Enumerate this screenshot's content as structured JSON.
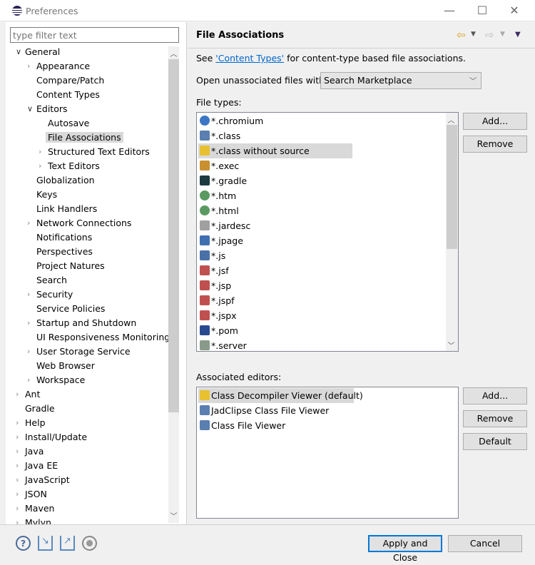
{
  "window": {
    "title": "Preferences",
    "minimize": "—",
    "maximize": "☐",
    "close": "✕"
  },
  "filter": {
    "placeholder": "type filter text"
  },
  "tree": [
    {
      "label": "General",
      "level": 0,
      "arrow": "expanded"
    },
    {
      "label": "Appearance",
      "level": 1,
      "arrow": "collapsed"
    },
    {
      "label": "Compare/Patch",
      "level": 1,
      "arrow": "none"
    },
    {
      "label": "Content Types",
      "level": 1,
      "arrow": "none"
    },
    {
      "label": "Editors",
      "level": 1,
      "arrow": "expanded"
    },
    {
      "label": "Autosave",
      "level": 2,
      "arrow": "none"
    },
    {
      "label": "File Associations",
      "level": 2,
      "arrow": "none",
      "selected": true
    },
    {
      "label": "Structured Text Editors",
      "level": 2,
      "arrow": "collapsed"
    },
    {
      "label": "Text Editors",
      "level": 2,
      "arrow": "collapsed"
    },
    {
      "label": "Globalization",
      "level": 1,
      "arrow": "none"
    },
    {
      "label": "Keys",
      "level": 1,
      "arrow": "none"
    },
    {
      "label": "Link Handlers",
      "level": 1,
      "arrow": "none"
    },
    {
      "label": "Network Connections",
      "level": 1,
      "arrow": "collapsed"
    },
    {
      "label": "Notifications",
      "level": 1,
      "arrow": "none"
    },
    {
      "label": "Perspectives",
      "level": 1,
      "arrow": "none"
    },
    {
      "label": "Project Natures",
      "level": 1,
      "arrow": "none"
    },
    {
      "label": "Search",
      "level": 1,
      "arrow": "none"
    },
    {
      "label": "Security",
      "level": 1,
      "arrow": "collapsed"
    },
    {
      "label": "Service Policies",
      "level": 1,
      "arrow": "none"
    },
    {
      "label": "Startup and Shutdown",
      "level": 1,
      "arrow": "collapsed"
    },
    {
      "label": "UI Responsiveness Monitoring",
      "level": 1,
      "arrow": "none"
    },
    {
      "label": "User Storage Service",
      "level": 1,
      "arrow": "collapsed"
    },
    {
      "label": "Web Browser",
      "level": 1,
      "arrow": "none"
    },
    {
      "label": "Workspace",
      "level": 1,
      "arrow": "collapsed"
    },
    {
      "label": "Ant",
      "level": 0,
      "arrow": "collapsed"
    },
    {
      "label": "Gradle",
      "level": 0,
      "arrow": "none"
    },
    {
      "label": "Help",
      "level": 0,
      "arrow": "collapsed"
    },
    {
      "label": "Install/Update",
      "level": 0,
      "arrow": "collapsed"
    },
    {
      "label": "Java",
      "level": 0,
      "arrow": "collapsed"
    },
    {
      "label": "Java EE",
      "level": 0,
      "arrow": "collapsed"
    },
    {
      "label": "JavaScript",
      "level": 0,
      "arrow": "collapsed"
    },
    {
      "label": "JSON",
      "level": 0,
      "arrow": "collapsed"
    },
    {
      "label": "Maven",
      "level": 0,
      "arrow": "collapsed"
    },
    {
      "label": "Mylyn",
      "level": 0,
      "arrow": "collapsed"
    }
  ],
  "page": {
    "title": "File Associations",
    "intro_prefix": "See ",
    "intro_link": "'Content Types'",
    "intro_suffix": " for content-type based file associations.",
    "open_label": "Open unassociated files with:",
    "open_value": "Search Marketplace",
    "file_types_label": "File types:",
    "file_types": [
      {
        "name": "*.chromium",
        "icon": "chromium-icon",
        "color": "#3a76c4"
      },
      {
        "name": "*.class",
        "icon": "class-file-icon",
        "color": "#5a7fb0"
      },
      {
        "name": "*.class without source",
        "icon": "class-decompiler-icon",
        "color": "#e8c030",
        "selected": true
      },
      {
        "name": "*.exec",
        "icon": "gears-icon",
        "color": "#c89030"
      },
      {
        "name": "*.gradle",
        "icon": "gradle-elephant-icon",
        "color": "#1c3a40"
      },
      {
        "name": "*.htm",
        "icon": "globe-icon",
        "color": "#5a9a60"
      },
      {
        "name": "*.html",
        "icon": "globe-icon",
        "color": "#5a9a60"
      },
      {
        "name": "*.jardesc",
        "icon": "jar-icon",
        "color": "#a0a0a0"
      },
      {
        "name": "*.jpage",
        "icon": "java-page-icon",
        "color": "#4070b0"
      },
      {
        "name": "*.js",
        "icon": "js-file-icon",
        "color": "#4a70a8"
      },
      {
        "name": "*.jsf",
        "icon": "text-file-icon",
        "color": "#c05050"
      },
      {
        "name": "*.jsp",
        "icon": "text-file-icon",
        "color": "#c05050"
      },
      {
        "name": "*.jspf",
        "icon": "text-file-icon",
        "color": "#c05050"
      },
      {
        "name": "*.jspx",
        "icon": "text-file-icon",
        "color": "#c05050"
      },
      {
        "name": "*.pom",
        "icon": "maven-file-icon",
        "color": "#2a4a90"
      },
      {
        "name": "*.server",
        "icon": "server-icon",
        "color": "#8a9a8a"
      }
    ],
    "file_buttons": {
      "add": "Add...",
      "remove": "Remove"
    },
    "editors_label": "Associated editors:",
    "editors": [
      {
        "name": "Class Decompiler Viewer (default)",
        "icon": "class-decompiler-icon",
        "color": "#e8c030",
        "selected": true
      },
      {
        "name": "JadClipse Class File Viewer",
        "icon": "class-file-icon",
        "color": "#5a7fb0"
      },
      {
        "name": "Class File Viewer",
        "icon": "class-file-icon",
        "color": "#5a7fb0"
      }
    ],
    "editor_buttons": {
      "add": "Add...",
      "remove": "Remove",
      "default": "Default"
    }
  },
  "footer": {
    "apply_close": "Apply and Close",
    "cancel": "Cancel"
  },
  "colors": {
    "accent": "#0078d7",
    "link": "#0066cc",
    "selection": "#d9d9d9"
  }
}
